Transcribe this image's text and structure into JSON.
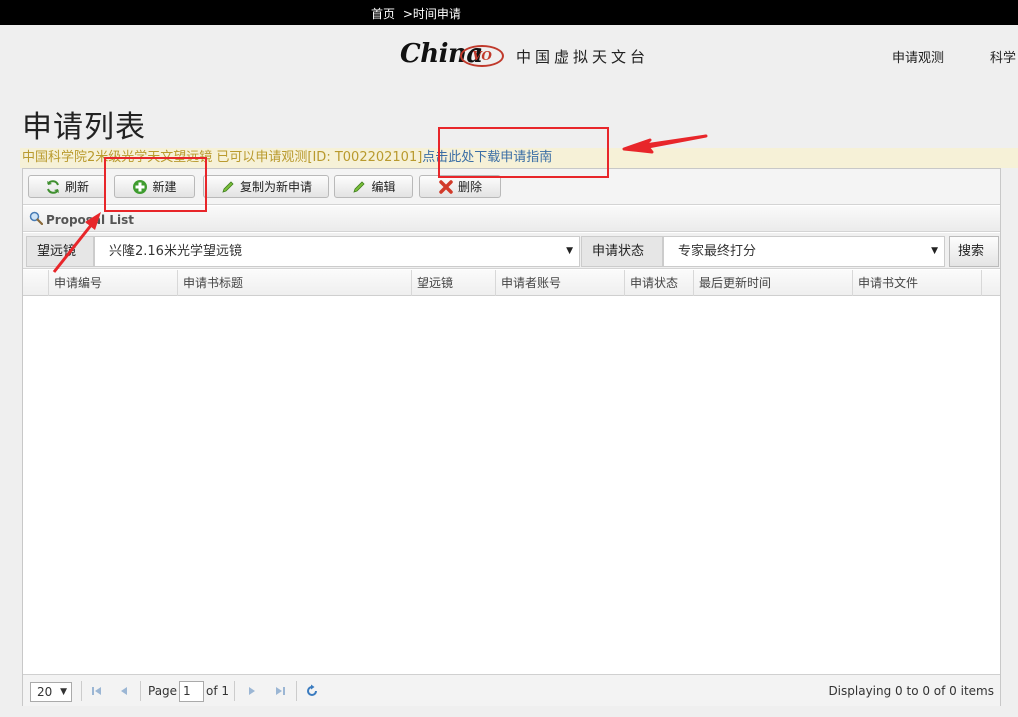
{
  "breadcrumb": {
    "home": "首页",
    "current": ">时间申请"
  },
  "header": {
    "logo_word": "China",
    "logo_vo": "VO",
    "logo_cn": "中国虚拟天文台",
    "nav": [
      "申请观测",
      "科学"
    ]
  },
  "page": {
    "title": "申请列表",
    "notice_message": "中国科学院2米级光学天文望远镜 已可以申请观测[ID: T002202101]",
    "notice_link": "点击此处下载申请指南"
  },
  "toolbar": {
    "refresh": "刷新",
    "new": "新建",
    "copy_new": "复制为新申请",
    "edit": "编辑",
    "delete": "删除"
  },
  "list": {
    "title": "Proposal List"
  },
  "filters": {
    "telescope_label": "望远镜",
    "telescope_value": "兴隆2.16米光学望远镜",
    "status_label": "申请状态",
    "status_value": "专家最终打分",
    "search": "搜索"
  },
  "columns": [
    "申请编号",
    "申请书标题",
    "望远镜",
    "申请者账号",
    "申请状态",
    "最后更新时间",
    "申请书文件"
  ],
  "rows": [],
  "pager": {
    "page_size": "20",
    "page_label": "Page",
    "page": "1",
    "of_label": "of 1",
    "display": "Displaying 0 to 0 of 0 items"
  },
  "colors": {
    "annotation": "#e8262a",
    "notice_bg": "#f6f1d7",
    "notice_text": "#b99a2e",
    "link": "#3a6ea5"
  }
}
